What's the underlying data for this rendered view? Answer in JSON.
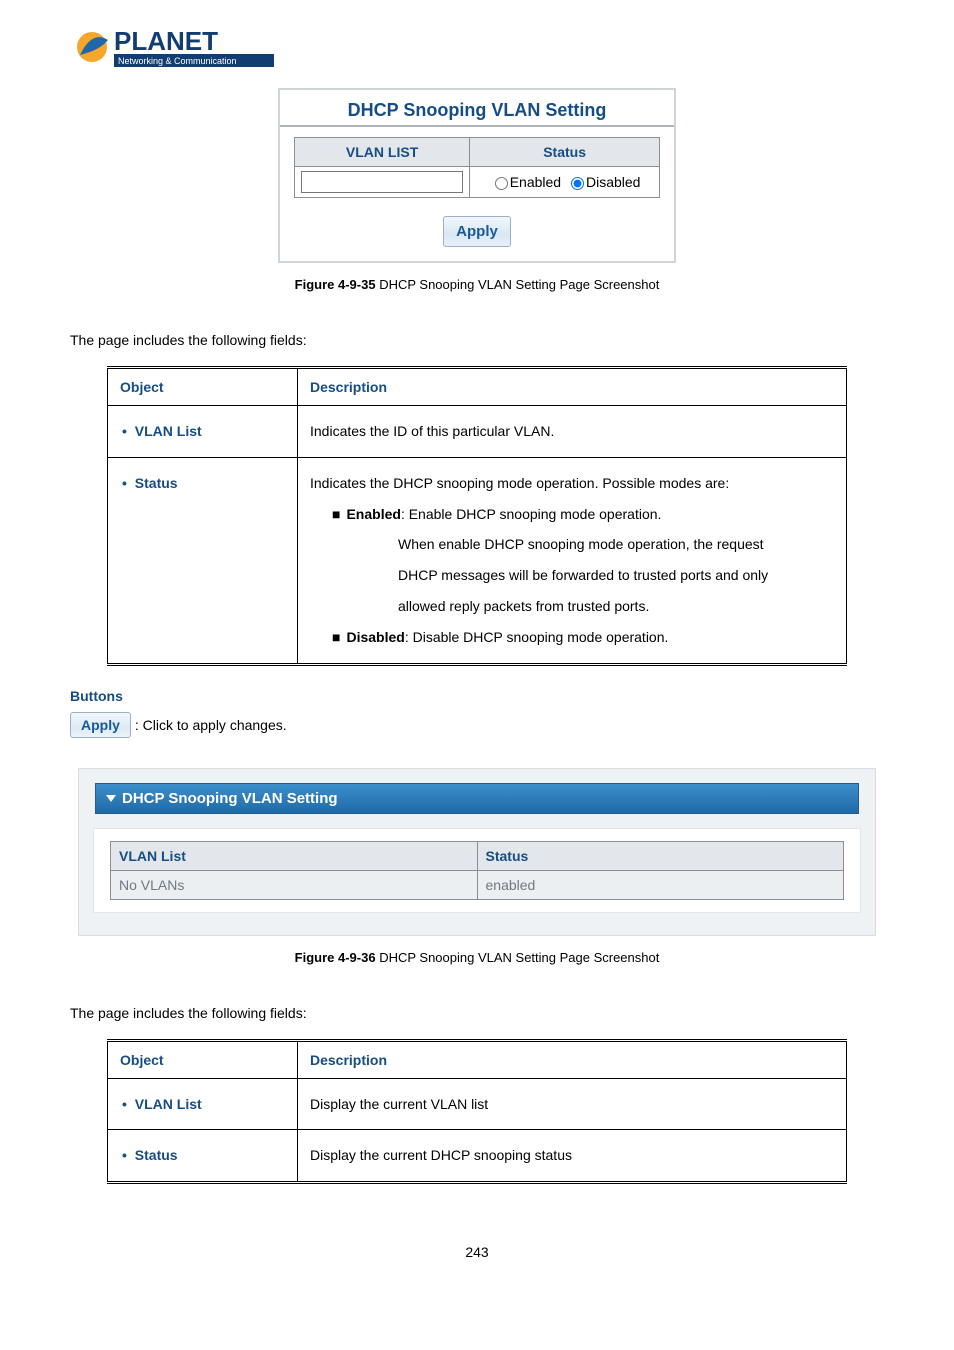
{
  "logo": {
    "brand_top": "PLANET",
    "brand_sub": "Networking & Communication"
  },
  "fig1": {
    "title": "DHCP Snooping VLAN Setting",
    "headers": {
      "vlan": "VLAN LIST",
      "status": "Status"
    },
    "input_value": "",
    "radios": {
      "enabled": "Enabled",
      "disabled": "Disabled"
    },
    "apply": "Apply",
    "caption_bold": "Figure 4-9-35",
    "caption_rest": " DHCP Snooping VLAN Setting Page Screenshot"
  },
  "intro1": "The page includes the following fields:",
  "table1": {
    "h_object": "Object",
    "h_desc": "Description",
    "rows": [
      {
        "obj": "VLAN List",
        "desc_plain": "Indicates the ID of this particular VLAN."
      }
    ],
    "status_obj": "Status",
    "status_lead": "Indicates the DHCP snooping mode operation. Possible modes are:",
    "status_enabled_b": "Enabled",
    "status_enabled_rest": ": Enable DHCP snooping mode operation.",
    "status_enabled_detail1": "When enable DHCP snooping mode operation, the request",
    "status_enabled_detail2": "DHCP messages will be forwarded to trusted ports and only",
    "status_enabled_detail3": "allowed reply packets from trusted ports.",
    "status_disabled_b": "Disabled",
    "status_disabled_rest": ": Disable DHCP snooping mode operation."
  },
  "buttons_section": {
    "heading": "Buttons",
    "apply": "Apply",
    "apply_desc": ": Click to apply changes."
  },
  "fig2": {
    "bar_title": "DHCP Snooping VLAN Setting",
    "headers": {
      "vlan": "VLAN List",
      "status": "Status"
    },
    "row": {
      "vlan": "No VLANs",
      "status": "enabled"
    },
    "caption_bold": "Figure 4-9-36",
    "caption_rest": " DHCP Snooping VLAN Setting Page Screenshot"
  },
  "intro2": "The page includes the following fields:",
  "table2": {
    "h_object": "Object",
    "h_desc": "Description",
    "rows": [
      {
        "obj": "VLAN List",
        "desc": "Display the current VLAN list"
      },
      {
        "obj": "Status",
        "desc": "Display the current DHCP snooping status"
      }
    ]
  },
  "page_number": "243"
}
